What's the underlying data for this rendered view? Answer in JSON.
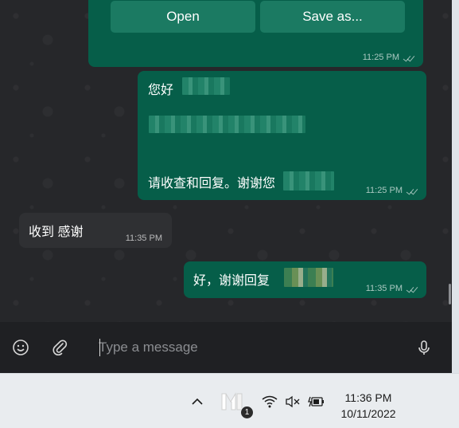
{
  "messages": {
    "file_card": {
      "open_label": "Open",
      "save_label": "Save as...",
      "time": "11:25 PM"
    },
    "message_1": {
      "greeting": "您好",
      "closing": "请收查和回复。谢谢您",
      "time": "11:25 PM"
    },
    "message_2": {
      "text": "收到 感谢",
      "time": "11:35 PM"
    },
    "message_3": {
      "text": "好，谢谢回复",
      "time": "11:35 PM"
    }
  },
  "composer": {
    "placeholder": "Type a message",
    "emoji_icon": "emoji-icon",
    "attach_icon": "paperclip-icon",
    "mic_icon": "microphone-icon"
  },
  "taskbar": {
    "time": "11:36 PM",
    "date": "10/11/2022",
    "notification_count": "1",
    "icons": [
      "chevron-up-icon",
      "app-tray-icon",
      "wifi-icon",
      "speaker-muted-icon",
      "battery-charging-icon"
    ]
  },
  "colors": {
    "outgoing_bubble": "#065e49",
    "incoming_bubble": "#2f3033",
    "chat_bg": "#26272a",
    "composer_bg": "#1f2023"
  }
}
